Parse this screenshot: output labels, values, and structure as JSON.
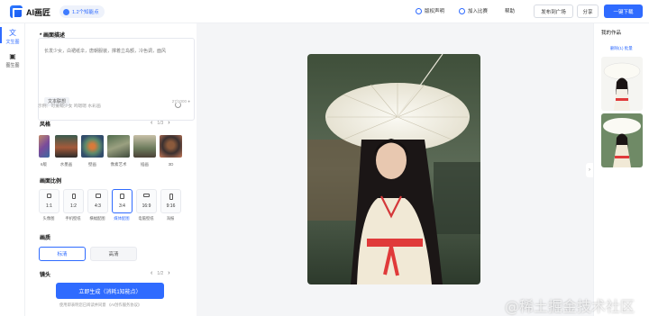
{
  "header": {
    "app_name": "AI画匠",
    "points_label": "1.2个知能点",
    "nav": {
      "copyright": "版权声明",
      "contest": "加入比赛",
      "help": "帮助",
      "publish": "发布到广场",
      "share": "分享",
      "download": "一键下载"
    }
  },
  "left_nav": [
    {
      "label": "文生图",
      "icon": "translate-icon",
      "active": true
    },
    {
      "label": "图生图",
      "icon": "image-icon",
      "active": false
    }
  ],
  "panel": {
    "prompt": {
      "title": "* 画面描述",
      "value": "长发少女，白裙纸伞，唐朝服装，撑着立岛额，冷色调，面风",
      "assoc_button": "文本联想",
      "counter": "27/1000",
      "example": "示例：可爱萌少女   鸣嗯嗯   水彩画"
    },
    "style": {
      "title": "风格",
      "page": "1/3",
      "items": [
        {
          "label": "6版"
        },
        {
          "label": "水墨画"
        },
        {
          "label": "壁画"
        },
        {
          "label": "像素艺术"
        },
        {
          "label": "插画"
        },
        {
          "label": "3D"
        }
      ]
    },
    "ratio": {
      "title": "画面比例",
      "items": [
        {
          "label": "1:1",
          "sub": "头像图",
          "active": false
        },
        {
          "label": "1:2",
          "sub": "手机壁纸",
          "active": false
        },
        {
          "label": "4:3",
          "sub": "横幅配图",
          "active": false
        },
        {
          "label": "3:4",
          "sub": "媒体配图",
          "active": true
        },
        {
          "label": "16:9",
          "sub": "电脑壁纸",
          "active": false
        },
        {
          "label": "9:16",
          "sub": "海报",
          "active": false
        }
      ]
    },
    "quality": {
      "title": "画质",
      "options": [
        "标清",
        "高清"
      ],
      "selected": "标清"
    },
    "lens": {
      "title": "镜头",
      "page": "1/2"
    },
    "generate_button": "立即生成（消耗1知能点）",
    "agreement": "使用即表明您已阅读并同意  《AI创作服务协议》"
  },
  "works": {
    "title": "我的作品",
    "subtitle": "删除(1)  批量",
    "count": 2
  },
  "watermark": "@稀土掘金技术社区",
  "colors": {
    "accent": "#2f6bff",
    "canvas_bg": "#f4f5f7"
  }
}
